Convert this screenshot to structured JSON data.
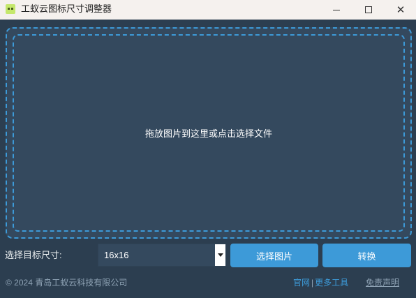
{
  "window": {
    "title": "工蚁云图标尺寸调整器",
    "app_icon": "ant-cloud-logo-icon",
    "controls": {
      "minimize": "minimize-icon",
      "maximize": "maximize-icon",
      "close": "close-icon",
      "close_glyph": "✕"
    }
  },
  "drop_zone": {
    "text": "拖放图片到这里或点击选择文件"
  },
  "controls": {
    "size_label": "选择目标尺寸:",
    "size_value": "16x16",
    "choose_button": "选择图片",
    "convert_button": "转换"
  },
  "footer": {
    "copyright": "© 2024 青岛工蚁云科技有限公司",
    "link_official": "官网",
    "separator": "|",
    "link_more_tools": "更多工具",
    "disclaimer": "免责声明"
  },
  "colors": {
    "accent": "#3d9ad8",
    "background": "#2c3e50",
    "panel": "#34495e",
    "titlebar": "#f5f1ee"
  }
}
